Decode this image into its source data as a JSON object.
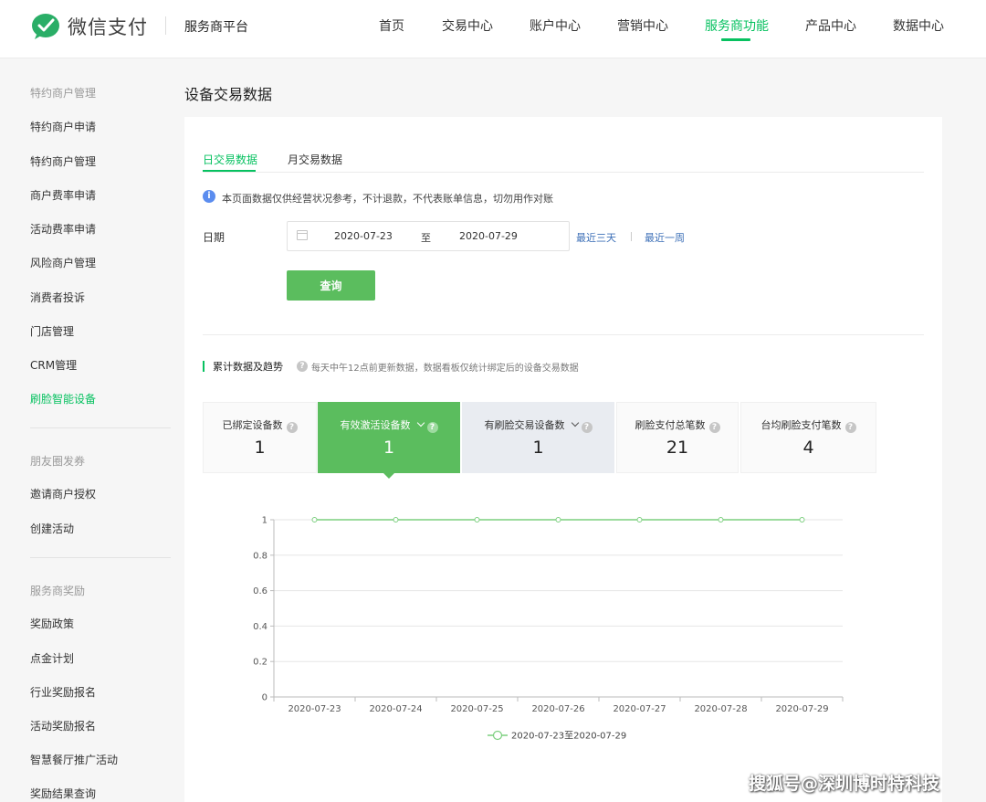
{
  "header": {
    "logo_text": "微信支付",
    "platform": "服务商平台",
    "nav": [
      {
        "label": "首页"
      },
      {
        "label": "交易中心"
      },
      {
        "label": "账户中心"
      },
      {
        "label": "营销中心"
      },
      {
        "label": "服务商功能",
        "active": true
      },
      {
        "label": "产品中心"
      },
      {
        "label": "数据中心"
      }
    ],
    "brand_color": "#07c160"
  },
  "sidebar": {
    "groups": [
      {
        "title": "特约商户管理",
        "items": [
          "特约商户申请",
          "特约商户管理",
          "商户费率申请",
          "活动费率申请",
          "风险商户管理",
          "消费者投诉",
          "门店管理",
          "CRM管理",
          "刷脸智能设备"
        ],
        "active_item": "刷脸智能设备"
      },
      {
        "title": "朋友圈发券",
        "items": [
          "邀请商户授权",
          "创建活动"
        ]
      },
      {
        "title": "服务商奖励",
        "items": [
          "奖励政策",
          "点金计划",
          "行业奖励报名",
          "活动奖励报名",
          "智慧餐厅推广活动",
          "奖励结果查询"
        ]
      }
    ]
  },
  "main": {
    "title": "设备交易数据",
    "tabs": [
      {
        "label": "日交易数据",
        "active": true
      },
      {
        "label": "月交易数据"
      }
    ],
    "info_icon": "info-icon",
    "notice": "本页面数据仅供经营状况参考，不计退款，不代表账单信息，切勿用作对账",
    "filter": {
      "date_label": "日期",
      "start_date": "2020-07-23",
      "to": "至",
      "end_date": "2020-07-29",
      "quick_links": [
        "最近三天",
        "最近一周"
      ],
      "query_button": "查询"
    },
    "section": {
      "title": "累计数据及趋势",
      "note": "每天中午12点前更新数据，数据看板仅统计绑定后的设备交易数据",
      "help": "?"
    },
    "metrics": [
      {
        "label": "已绑定设备数",
        "value": "1",
        "dropdown": false
      },
      {
        "label": "有效激活设备数",
        "value": "1",
        "dropdown": true,
        "active": true
      },
      {
        "label": "有刷脸交易设备数",
        "value": "1",
        "dropdown": true,
        "hover": true
      },
      {
        "label": "刷脸支付总笔数",
        "value": "21",
        "dropdown": false
      },
      {
        "label": "台均刷脸支付笔数",
        "value": "4",
        "dropdown": false
      }
    ]
  },
  "chart_data": {
    "type": "line",
    "x": [
      "2020-07-23",
      "2020-07-24",
      "2020-07-25",
      "2020-07-26",
      "2020-07-27",
      "2020-07-28",
      "2020-07-29"
    ],
    "series": [
      {
        "name": "2020-07-23至2020-07-29",
        "values": [
          1,
          1,
          1,
          1,
          1,
          1,
          1
        ],
        "color": "#7ccf7f"
      }
    ],
    "yticks": [
      "0",
      "0.2",
      "0.4",
      "0.6",
      "0.8",
      "1"
    ],
    "ylim": [
      0,
      1
    ],
    "grid": true,
    "legend": "bottom-center",
    "title": "",
    "xlabel": "",
    "ylabel": ""
  },
  "watermark": "搜狐号@深圳博时特科技"
}
